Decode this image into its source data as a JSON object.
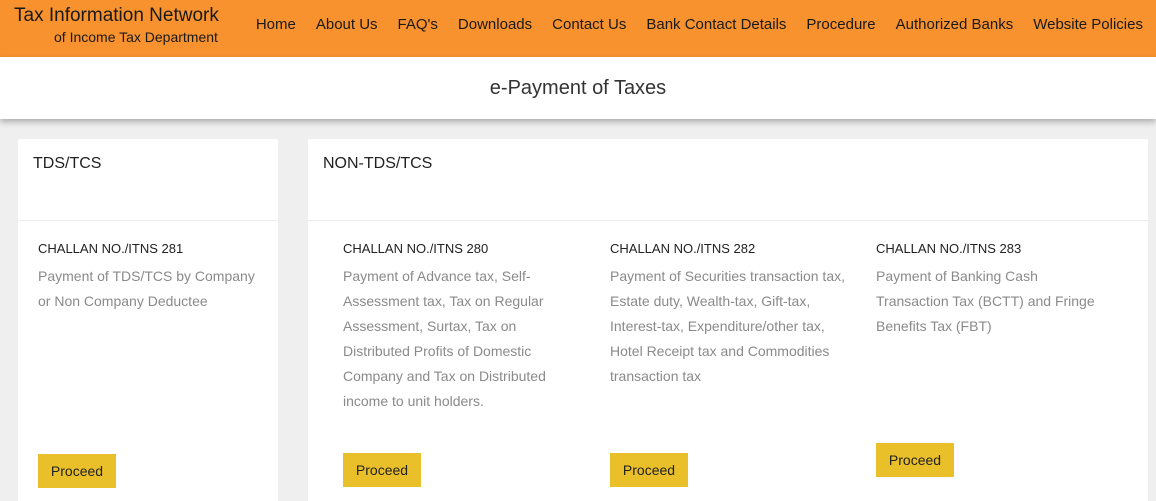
{
  "header": {
    "brand_line1": "Tax Information Network",
    "brand_line2": "of Income Tax Department",
    "nav": [
      "Home",
      "About Us",
      "FAQ's",
      "Downloads",
      "Contact Us",
      "Bank Contact Details",
      "Procedure",
      "Authorized Banks",
      "Website Policies"
    ],
    "bg_color": "#f7922f"
  },
  "page": {
    "title": "e-Payment of Taxes"
  },
  "tds": {
    "title": "TDS/TCS",
    "challans": [
      {
        "number": "CHALLAN NO./ITNS 281",
        "description": "Payment of TDS/TCS by Company or Non Company Deductee",
        "button": "Proceed"
      }
    ]
  },
  "non_tds": {
    "title": "NON-TDS/TCS",
    "challans": [
      {
        "number": "CHALLAN NO./ITNS 280",
        "description": "Payment of Advance tax, Self-Assessment tax, Tax on Regular Assessment, Surtax, Tax on Distributed Profits of Domestic Company and Tax on Distributed income to unit holders.",
        "button": "Proceed"
      },
      {
        "number": "CHALLAN NO./ITNS 282",
        "description": "Payment of Securities transaction tax, Estate duty, Wealth-tax, Gift-tax, Interest-tax, Expenditure/other tax, Hotel Receipt tax and Commodities transaction tax",
        "button": "Proceed"
      },
      {
        "number": "CHALLAN NO./ITNS 283",
        "description": "Payment of Banking Cash Transaction Tax (BCTT) and Fringe Benefits Tax (FBT)",
        "button": "Proceed"
      }
    ]
  },
  "colors": {
    "button_bg": "#e9c02a",
    "description_text": "#8a8a8a"
  }
}
